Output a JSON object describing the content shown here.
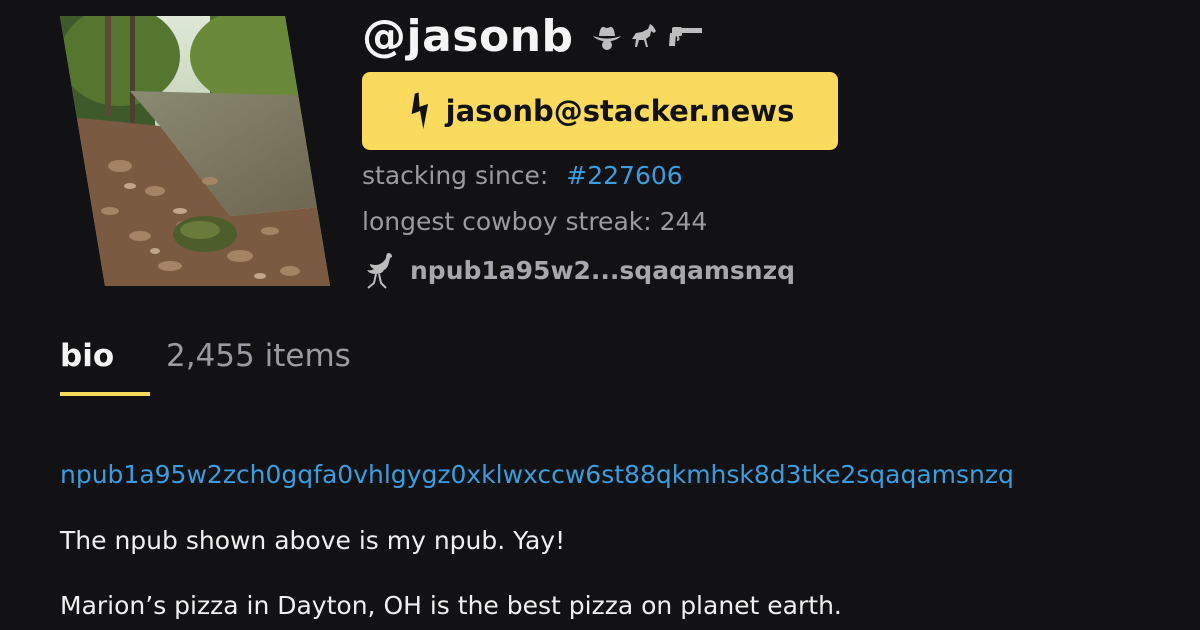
{
  "profile": {
    "handle": "@jasonb",
    "badges": [
      "cowboy-hat-icon",
      "horse-icon",
      "gun-icon"
    ],
    "lightning_address": "jasonb@stacker.news",
    "stacking_since_label": "stacking since:",
    "stacking_since_value": "#227606",
    "streak_text": "longest cowboy streak: 244",
    "npub_short": "npub1a95w2...sqaqamsnzq"
  },
  "tabs": [
    {
      "label": "bio",
      "active": true
    },
    {
      "label": "2,455 items",
      "active": false
    }
  ],
  "bio": {
    "npub_link": "npub1a95w2zch0gqfa0vhlgygz0xklwxccw6st88qkmhsk8d3tke2sqaqamsnzq",
    "paragraphs": [
      "The npub shown above is my npub. Yay!",
      "Marion’s pizza in Dayton, OH is the best pizza on planet earth."
    ]
  },
  "colors": {
    "background": "#121214",
    "accent": "#fadb5e",
    "link": "#3b9cde",
    "muted": "#9a9aa0"
  }
}
